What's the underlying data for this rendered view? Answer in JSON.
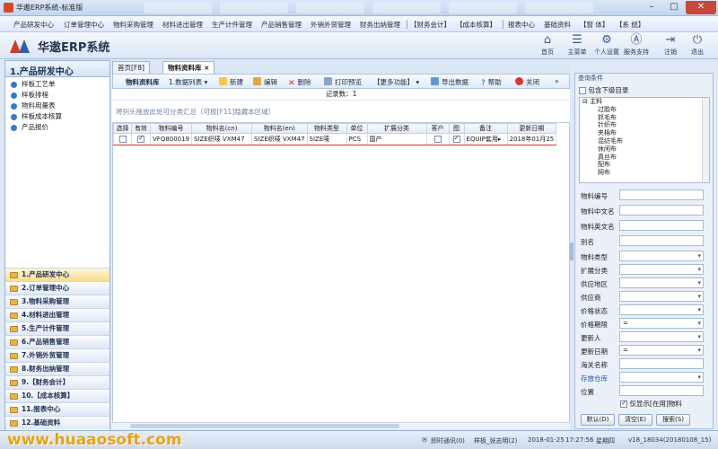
{
  "window": {
    "title": "华遨ERP系统-标准版"
  },
  "menu": [
    "产品研发中心",
    "订单管理中心",
    "物料采购管理",
    "材料进出管理",
    "生产计件管理",
    "产品销售管理",
    "外销外贸管理",
    "财务出纳管理",
    "【财务会计】",
    "【成本核算】",
    "报表中心",
    "基础资料",
    "【窗 体】",
    "【系 统】"
  ],
  "header": {
    "app_name": "华遨ERP系统",
    "buttons": [
      {
        "label": "首页",
        "icon": "home-icon"
      },
      {
        "label": "主菜单",
        "icon": "menu-icon"
      },
      {
        "label": "个人设置",
        "icon": "gear-icon"
      },
      {
        "label": "服务支持",
        "icon": "support-icon"
      },
      {
        "label": "注销",
        "icon": "logout-icon"
      },
      {
        "label": "退出",
        "icon": "power-icon"
      }
    ]
  },
  "sidebar": {
    "title": "1.产品研发中心",
    "items": [
      "样板工艺单",
      "样板排程",
      "物料用量表",
      "样板成本核算",
      "产品报价"
    ],
    "modules": [
      "1.产品研发中心",
      "2.订单管理中心",
      "3.物料采购管理",
      "4.材料进出管理",
      "5.生产计件管理",
      "6.产品销售管理",
      "7.外销外贸管理",
      "8.财务出纳管理",
      "9.【财务会计】",
      "10.【成本核算】",
      "11.报表中心",
      "12.基础资料"
    ]
  },
  "tabs": [
    {
      "label": "首页[F8]",
      "active": false
    },
    {
      "label": "物料资料库",
      "active": true,
      "close": "×"
    }
  ],
  "toolbar": {
    "items": [
      {
        "label": "物料资料库",
        "icon": ""
      },
      {
        "label": "1.数据列表 ▾",
        "icon": ""
      },
      {
        "label": "新建",
        "icon": "new-icon"
      },
      {
        "label": "编辑",
        "icon": "edit-icon"
      },
      {
        "label": "删除",
        "icon": "delete-icon"
      },
      {
        "label": "打印预览",
        "icon": "print-icon"
      },
      {
        "label": "【更多功能】 ▾",
        "icon": ""
      },
      {
        "label": "导出数据",
        "icon": "export-icon"
      },
      {
        "label": "帮助",
        "icon": "help-icon"
      },
      {
        "label": "关闭",
        "icon": "close-icon"
      }
    ]
  },
  "grid": {
    "record_count": "记录数：1",
    "group_hint": "将列头拖放此处可分类汇总（可按[F11]隐藏本区域）",
    "columns": [
      "选择",
      "有效",
      "物料编号",
      "物料名(cn)",
      "物料名(en)",
      "物料类型",
      "单位",
      "扩展分类",
      "客户",
      "图",
      "备注",
      "更新日期"
    ],
    "rows": [
      {
        "select": false,
        "valid": true,
        "code": "VFQ800019",
        "name_cn": "SIZE织唛 VXM47",
        "name_en": "SIZE织唛 VXM47",
        "type": "SIZE唛",
        "unit": "PCS",
        "ext": "国产",
        "customer": false,
        "pic": true,
        "remark": "EQUIP套用▸",
        "date": "2018年01月25"
      }
    ]
  },
  "filter": {
    "title": "查询条件",
    "include_sub": "包含下级目录",
    "tree": [
      "⊟ 主料",
      "过胶布",
      "抓毛布",
      "针织布",
      "夹棉布",
      "混纺毛布",
      "休闲布",
      "真丝布",
      "配布",
      "网布"
    ],
    "fields": [
      {
        "label": "物料编号",
        "value": "",
        "dropdown": false,
        "link": false
      },
      {
        "label": "物料中文名",
        "value": "",
        "dropdown": false,
        "link": false
      },
      {
        "label": "物料英文名",
        "value": "",
        "dropdown": false,
        "link": false
      },
      {
        "label": "别名",
        "value": "",
        "dropdown": false,
        "link": false
      },
      {
        "label": "物料类型",
        "value": "",
        "dropdown": true,
        "link": false
      },
      {
        "label": "扩展分类",
        "value": "",
        "dropdown": true,
        "link": false
      },
      {
        "label": "供应地区",
        "value": "",
        "dropdown": true,
        "link": false
      },
      {
        "label": "供应商",
        "value": "",
        "dropdown": true,
        "link": false
      },
      {
        "label": "价格状态",
        "value": "",
        "dropdown": true,
        "link": false
      },
      {
        "label": "价格期限",
        "value": "=",
        "dropdown": true,
        "link": false
      },
      {
        "label": "更新人",
        "value": "",
        "dropdown": true,
        "link": false
      },
      {
        "label": "更新日期",
        "value": "=",
        "dropdown": true,
        "link": false
      },
      {
        "label": "海关名称",
        "value": "",
        "dropdown": false,
        "link": false
      },
      {
        "label": "存放仓库",
        "value": "",
        "dropdown": true,
        "link": true
      },
      {
        "label": "位置",
        "value": "",
        "dropdown": false,
        "link": false
      }
    ],
    "only_in_use": "仅显示[在用]物料",
    "buttons": [
      "默认(D)",
      "清空(E)",
      "搜索(S)"
    ]
  },
  "statusbar": {
    "watermark": "www.huaaosoft.com",
    "items": [
      "即时通讯(0)",
      "样板_张志明(2)",
      "2018-01-25",
      "17:27:56",
      "星期四",
      "v18_18034(20180108_15)"
    ]
  }
}
